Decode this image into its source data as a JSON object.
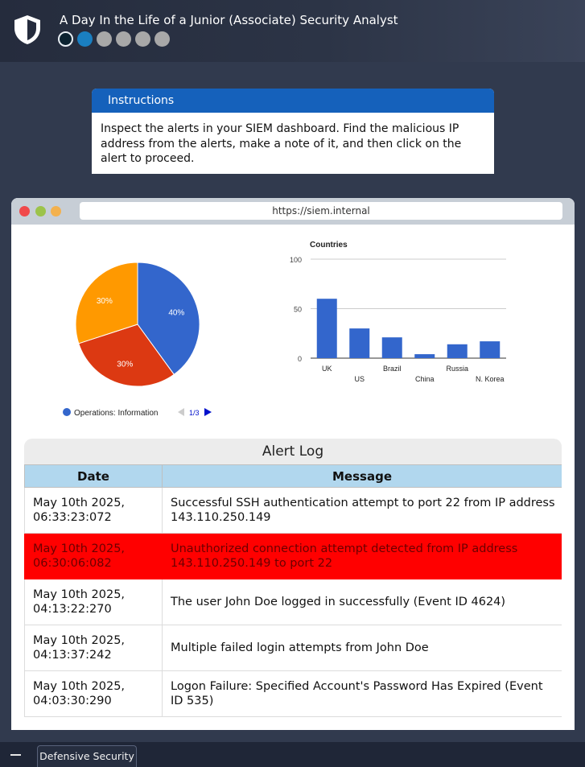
{
  "header": {
    "title": "A Day In the Life of a Junior (Associate) Security Analyst",
    "steps": [
      "current",
      "done",
      "pending",
      "pending",
      "pending",
      "pending"
    ]
  },
  "instructions": {
    "heading": "Instructions",
    "body": "Inspect the alerts in your SIEM dashboard. Find the malicious IP address from the alerts, make a note of it, and then click on the alert to proceed."
  },
  "browser": {
    "url": "https://siem.internal"
  },
  "pie_legend": {
    "label": "Operations: Information",
    "page": "1/3"
  },
  "chart_data": [
    {
      "type": "pie",
      "slices": [
        {
          "value": 40,
          "label": "40%",
          "color": "#3366cc"
        },
        {
          "value": 30,
          "label": "30%",
          "color": "#dc3912"
        },
        {
          "value": 30,
          "label": "30%",
          "color": "#ff9900"
        }
      ],
      "legend": [
        "Operations: Information"
      ]
    },
    {
      "type": "bar",
      "title": "Countries",
      "categories": [
        "UK",
        "US",
        "Brazil",
        "China",
        "Russia",
        "N. Korea"
      ],
      "values": [
        60,
        30,
        21,
        4,
        14,
        17
      ],
      "ylim": [
        0,
        100
      ],
      "yticks": [
        0,
        50,
        100
      ],
      "color": "#3366cc"
    }
  ],
  "alert_log": {
    "title": "Alert Log",
    "columns": [
      "Date",
      "Message"
    ],
    "rows": [
      {
        "date": "May 10th 2025, 06:33:23:072",
        "message": "Successful SSH authentication attempt to port 22 from IP address 143.110.250.149"
      },
      {
        "date": "May 10th 2025, 06:30:06:082",
        "message": "Unauthorized connection attempt detected from IP address 143.110.250.149 to port 22",
        "highlight": true,
        "highlight_color": "#ff0000"
      },
      {
        "date": "May 10th 2025, 04:13:22:270",
        "message": "The user John Doe logged in successfully (Event ID 4624)"
      },
      {
        "date": "May 10th 2025, 04:13:37:242",
        "message": "Multiple failed login attempts from John Doe"
      },
      {
        "date": "May 10th 2025, 04:03:30:290",
        "message": "Logon Failure: Specified Account's Password Has Expired (Event ID 535)"
      }
    ]
  },
  "taskbar": {
    "tab_label": "Defensive Security"
  }
}
